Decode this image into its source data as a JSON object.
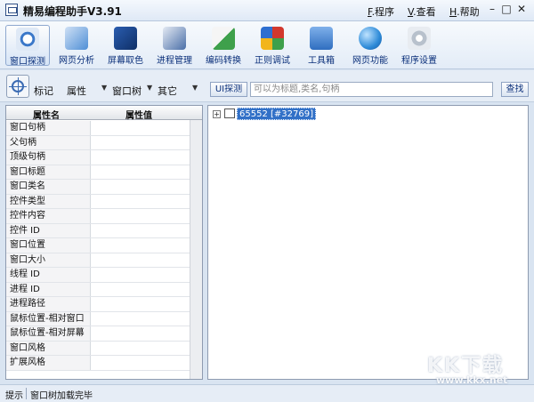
{
  "window": {
    "title": "精易编程助手V3.91",
    "menus": [
      {
        "key": "F",
        "label": ".程序"
      },
      {
        "key": "V",
        "label": ".查看"
      },
      {
        "key": "H",
        "label": ".帮助"
      }
    ],
    "controls": {
      "minimize": "–",
      "maximize": "□",
      "close": "✕"
    }
  },
  "toolbar": {
    "items": [
      {
        "label": "窗口探测",
        "icon": "window-probe-icon",
        "color": "#3b78c9",
        "active": true
      },
      {
        "label": "网页分析",
        "icon": "webpage-analysis-icon",
        "color": "#4f8fd6",
        "active": false
      },
      {
        "label": "屏幕取色",
        "icon": "color-picker-icon",
        "color": "#1f4f9a",
        "active": false
      },
      {
        "label": "进程管理",
        "icon": "process-manager-icon",
        "color": "#4a6fa8",
        "active": false
      },
      {
        "label": "编码转换",
        "icon": "encoding-convert-icon",
        "color": "#3ea04b",
        "active": false
      },
      {
        "label": "正则调试",
        "icon": "regex-debug-icon",
        "color": "#d2382d",
        "active": false
      },
      {
        "label": "工具箱",
        "icon": "toolbox-icon",
        "color": "#2f6ec0",
        "active": false
      },
      {
        "label": "网页功能",
        "icon": "web-function-icon",
        "color": "#2e8bd8",
        "active": false
      },
      {
        "label": "程序设置",
        "icon": "settings-icon",
        "color": "#b8c1cc",
        "active": false
      }
    ]
  },
  "filter_bar": {
    "options": [
      "标记",
      "属性",
      "窗口树",
      "其它"
    ],
    "ui_button": "UI探测",
    "search_placeholder": "可以为标题,类名,句柄",
    "search_value": "",
    "find_button": "查找"
  },
  "properties": {
    "headers": [
      "属性名",
      "属性值"
    ],
    "rows": [
      {
        "name": "窗口句柄",
        "value": ""
      },
      {
        "name": "父句柄",
        "value": ""
      },
      {
        "name": "顶级句柄",
        "value": ""
      },
      {
        "name": "窗口标题",
        "value": ""
      },
      {
        "name": "窗口类名",
        "value": ""
      },
      {
        "name": "控件类型",
        "value": ""
      },
      {
        "name": "控件内容",
        "value": ""
      },
      {
        "name": "控件 ID",
        "value": ""
      },
      {
        "name": "窗口位置",
        "value": ""
      },
      {
        "name": "窗口大小",
        "value": ""
      },
      {
        "name": "线程 ID",
        "value": ""
      },
      {
        "name": "进程 ID",
        "value": ""
      },
      {
        "name": "进程路径",
        "value": ""
      },
      {
        "name": "鼠标位置-相对窗口",
        "value": ""
      },
      {
        "name": "鼠标位置-相对屏幕",
        "value": ""
      },
      {
        "name": "窗口风格",
        "value": ""
      },
      {
        "name": "扩展风格",
        "value": ""
      }
    ]
  },
  "tree": {
    "root": {
      "label": "65552 [#32769]",
      "expander": "+"
    }
  },
  "status": {
    "label": "提示",
    "message": "窗口树加载完毕"
  },
  "watermark": {
    "logo": "KK下载",
    "url": "www.kkx.net"
  }
}
